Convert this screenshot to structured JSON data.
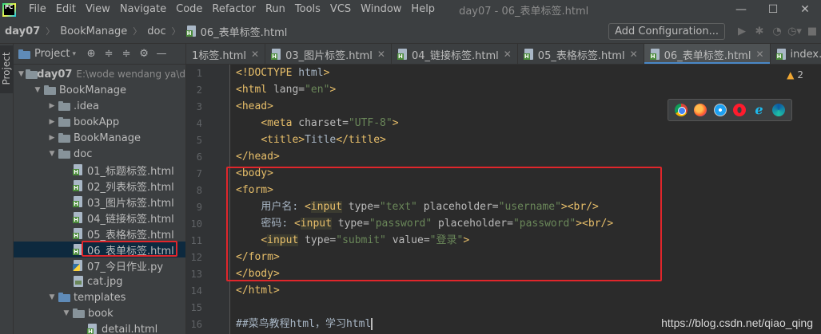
{
  "menubar": {
    "logo_text": "PC",
    "items": [
      "File",
      "Edit",
      "View",
      "Navigate",
      "Code",
      "Refactor",
      "Run",
      "Tools",
      "VCS",
      "Window",
      "Help"
    ],
    "window_title": "day07 - 06_表单标签.html",
    "controls": [
      "—",
      "☐",
      "✕"
    ]
  },
  "navbar": {
    "crumbs": [
      "day07",
      "BookManage",
      "doc",
      "06_表单标签.html"
    ],
    "add_config_label": "Add Configuration..."
  },
  "side_strip": {
    "label": "Project"
  },
  "project_panel": {
    "title": "Project",
    "tree": [
      {
        "label": "day07",
        "hint": "E:\\wode wendang ya\\d",
        "level": 0,
        "kind": "folder",
        "open": true,
        "bold": true
      },
      {
        "label": "BookManage",
        "level": 1,
        "kind": "folder",
        "open": true
      },
      {
        "label": ".idea",
        "level": 2,
        "kind": "folder",
        "open": false
      },
      {
        "label": "bookApp",
        "level": 2,
        "kind": "folder",
        "open": false
      },
      {
        "label": "BookManage",
        "level": 2,
        "kind": "folder",
        "open": false
      },
      {
        "label": "doc",
        "level": 2,
        "kind": "folder",
        "open": true
      },
      {
        "label": "01_标题标签.html",
        "level": 3,
        "kind": "html"
      },
      {
        "label": "02_列表标签.html",
        "level": 3,
        "kind": "html"
      },
      {
        "label": "03_图片标签.html",
        "level": 3,
        "kind": "html"
      },
      {
        "label": "04_链接标签.html",
        "level": 3,
        "kind": "html"
      },
      {
        "label": "05_表格标签.html",
        "level": 3,
        "kind": "html"
      },
      {
        "label": "06_表单标签.html",
        "level": 3,
        "kind": "html",
        "selected": true
      },
      {
        "label": "07_今日作业.py",
        "level": 3,
        "kind": "py"
      },
      {
        "label": "cat.jpg",
        "level": 3,
        "kind": "img"
      },
      {
        "label": "templates",
        "level": 2,
        "kind": "folder",
        "open": true,
        "blue": true
      },
      {
        "label": "book",
        "level": 3,
        "kind": "folder",
        "open": true
      },
      {
        "label": "detail.html",
        "level": 4,
        "kind": "html"
      }
    ]
  },
  "tabs": [
    {
      "label": "1标签.html",
      "active": false
    },
    {
      "label": "03_图片标签.html",
      "active": false
    },
    {
      "label": "04_链接标签.html",
      "active": false
    },
    {
      "label": "05_表格标签.html",
      "active": false
    },
    {
      "label": "06_表单标签.html",
      "active": true
    },
    {
      "label": "index.html",
      "active": false
    }
  ],
  "editor": {
    "warning_count": "2",
    "line_numbers": [
      "1",
      "2",
      "3",
      "4",
      "5",
      "6",
      "7",
      "8",
      "9",
      "10",
      "11",
      "12",
      "13",
      "14",
      "15",
      "16"
    ],
    "lines": [
      "<!DOCTYPE html>",
      "<html lang=\"en\">",
      "<head>",
      "    <meta charset=\"UTF-8\">",
      "    <title>Title</title>",
      "</head>",
      "<body>",
      "<form>",
      "    用户名: <input type=\"text\" placeholder=\"username\"><br/>",
      "    密码: <input type=\"password\" placeholder=\"password\"><br/>",
      "    <input type=\"submit\" value=\"登录\">",
      "</form>",
      "</body>",
      "</html>",
      "",
      "##菜鸟教程html，学习html"
    ]
  },
  "watermark": "https://blog.csdn.net/qiao_qing"
}
